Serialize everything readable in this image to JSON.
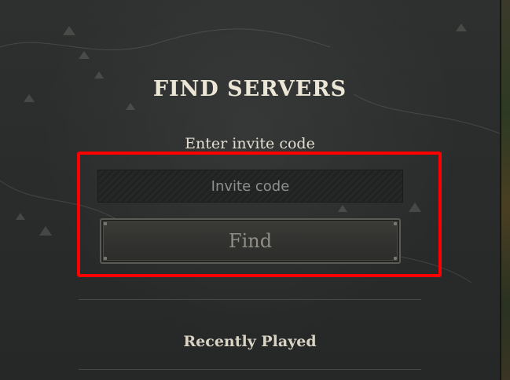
{
  "find_servers": {
    "title": "FIND SERVERS",
    "subtitle": "Enter invite code",
    "invite_input": {
      "placeholder": "Invite code",
      "value": ""
    },
    "find_button_label": "Find",
    "recently_played_label": "Recently Played"
  },
  "colors": {
    "highlight": "#ff0000",
    "title_text": "#ece6d6",
    "panel_bg": "#2a2c2c"
  }
}
